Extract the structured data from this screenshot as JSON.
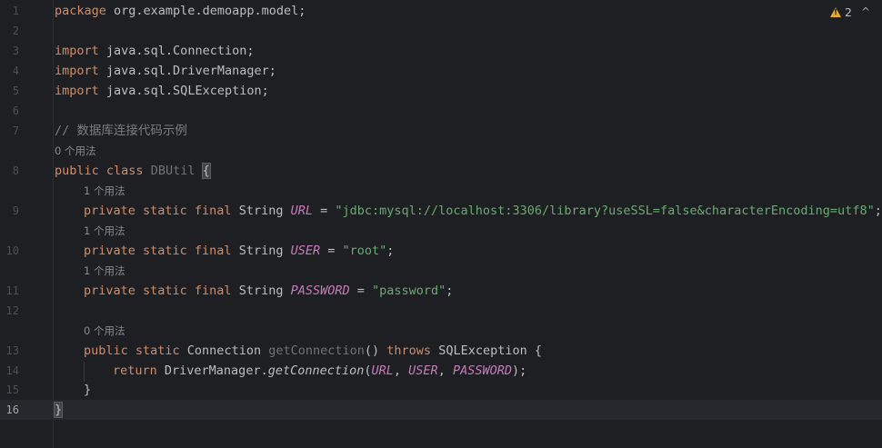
{
  "inspections": {
    "warning_count": "2",
    "collapse_label": "^"
  },
  "lines": [
    {
      "n": "1",
      "tokens": [
        [
          "kw",
          "package"
        ],
        [
          "",
          " org.example.demoapp.model;"
        ]
      ]
    },
    {
      "n": "2",
      "tokens": []
    },
    {
      "n": "3",
      "tokens": [
        [
          "kw",
          "import"
        ],
        [
          "",
          " java.sql.Connection;"
        ]
      ]
    },
    {
      "n": "4",
      "tokens": [
        [
          "kw",
          "import"
        ],
        [
          "",
          " java.sql.DriverManager;"
        ]
      ]
    },
    {
      "n": "5",
      "tokens": [
        [
          "kw",
          "import"
        ],
        [
          "",
          " java.sql.SQLException;"
        ]
      ]
    },
    {
      "n": "6",
      "tokens": []
    },
    {
      "n": "7",
      "tokens": [
        [
          "cmt",
          "// 数据库连接代码示例"
        ]
      ]
    },
    {
      "hint": "0 个用法",
      "indent": 0
    },
    {
      "n": "8",
      "tokens": [
        [
          "kw",
          "public class"
        ],
        [
          "",
          " "
        ],
        [
          "unused",
          "DBUtil"
        ],
        [
          "",
          " "
        ],
        [
          "bracket",
          "{"
        ]
      ]
    },
    {
      "hint": "1 个用法",
      "indent": 1
    },
    {
      "n": "9",
      "indent": 1,
      "tokens": [
        [
          "kw",
          "private static final"
        ],
        [
          "",
          " String "
        ],
        [
          "fld",
          "URL"
        ],
        [
          "",
          " = "
        ],
        [
          "str",
          "\"jdbc:mysql://localhost:3306/library?useSSL=false&characterEncoding=utf8\""
        ],
        [
          "",
          ";"
        ]
      ]
    },
    {
      "hint": "1 个用法",
      "indent": 1
    },
    {
      "n": "10",
      "indent": 1,
      "tokens": [
        [
          "kw",
          "private static final"
        ],
        [
          "",
          " String "
        ],
        [
          "fld",
          "USER"
        ],
        [
          "",
          " = "
        ],
        [
          "str",
          "\"root\""
        ],
        [
          "",
          ";"
        ]
      ]
    },
    {
      "hint": "1 个用法",
      "indent": 1
    },
    {
      "n": "11",
      "indent": 1,
      "tokens": [
        [
          "kw",
          "private static final"
        ],
        [
          "",
          " String "
        ],
        [
          "fld",
          "PASSWORD"
        ],
        [
          "",
          " = "
        ],
        [
          "str",
          "\"password\""
        ],
        [
          "",
          ";"
        ]
      ]
    },
    {
      "n": "12",
      "tokens": []
    },
    {
      "hint": "0 个用法",
      "indent": 1
    },
    {
      "n": "13",
      "indent": 1,
      "tokens": [
        [
          "kw",
          "public static"
        ],
        [
          "",
          " Connection "
        ],
        [
          "unused",
          "getConnection"
        ],
        [
          "",
          "() "
        ],
        [
          "kw",
          "throws"
        ],
        [
          "",
          " SQLException {"
        ]
      ]
    },
    {
      "n": "14",
      "indent": 2,
      "tokens": [
        [
          "kw",
          "return"
        ],
        [
          "",
          " DriverManager."
        ],
        [
          "mth-it",
          "getConnection"
        ],
        [
          "",
          "("
        ],
        [
          "fld",
          "URL"
        ],
        [
          "",
          ", "
        ],
        [
          "fld",
          "USER"
        ],
        [
          "",
          ", "
        ],
        [
          "fld",
          "PASSWORD"
        ],
        [
          "",
          ");"
        ]
      ]
    },
    {
      "n": "15",
      "indent": 1,
      "tokens": [
        [
          "",
          "}"
        ]
      ]
    },
    {
      "n": "16",
      "current": true,
      "tokens": [
        [
          "bracket",
          "}"
        ]
      ]
    }
  ]
}
